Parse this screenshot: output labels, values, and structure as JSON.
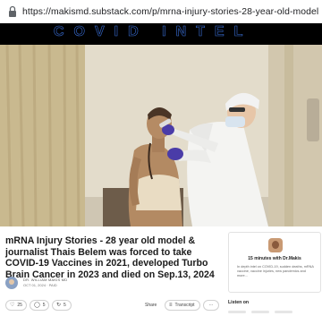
{
  "browser": {
    "url": "https://makismd.substack.com/p/mrna-injury-stories-28-year-old-model"
  },
  "banner": {
    "brand": "COVID INTEL"
  },
  "post": {
    "title": "mRNA Injury Stories - 28 year old model & journalist Thais Belem was forced to take COVID-19 Vaccines in 2021, developed Turbo Brain Cancer in 2023 and died on Sep.13, 2024",
    "author": "DR. WILLIAM MAKIS MD",
    "date": "OCT 01, 2024 · PAID"
  },
  "actions": {
    "likes": "25",
    "comments": "5",
    "restacks": "5",
    "share": "Share",
    "transcript": "Transcript",
    "more": "···"
  },
  "sidebar": {
    "card_title": "15 minutes with Dr.Makis",
    "card_desc": "In depth intel on COVID-19, sudden deaths, mRNA vaccine, vaccine injuries, new pandemics and more...",
    "listen_label": "Listen on"
  },
  "colors": {
    "strip": "#000000",
    "brand_outline": "#3a6fd8",
    "video_bg": "#d9c9a8"
  }
}
